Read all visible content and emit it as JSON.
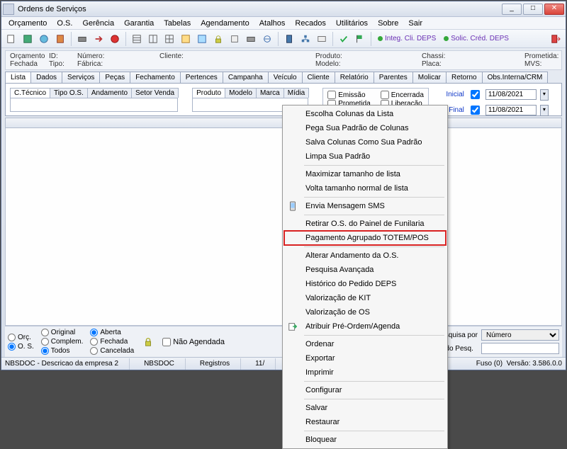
{
  "window": {
    "title": "Ordens de Serviços"
  },
  "menu": [
    "Orçamento",
    "O.S.",
    "Gerência",
    "Garantia",
    "Tabelas",
    "Agendamento",
    "Atalhos",
    "Recados",
    "Utilitários",
    "Sobre",
    "Sair"
  ],
  "toolbar_links": {
    "integ": "Integ. Cli. DEPS",
    "solic": "Solic. Créd. DEPS"
  },
  "info": {
    "r1": [
      "Orçamento",
      "ID:",
      "Número:",
      "",
      "Cliente:",
      "",
      "Produto:",
      "",
      "Chassi:",
      "",
      "Prometida:"
    ],
    "r2": [
      "Fechada",
      "Tipo:",
      "Fábrica:",
      "",
      "",
      "",
      "Modelo:",
      "",
      "Placa:",
      "",
      "MVS:"
    ]
  },
  "tabs": [
    "Lista",
    "Dados",
    "Serviços",
    "Peças",
    "Fechamento",
    "Pertences",
    "Campanha",
    "Veículo",
    "Cliente",
    "Relatório",
    "Parentes",
    "Molicar",
    "Retorno",
    "Obs.Interna/CRM"
  ],
  "subtabs1": [
    "C.Técnico",
    "Tipo O.S.",
    "Andamento",
    "Setor Venda"
  ],
  "subtabs2": [
    "Produto",
    "Modelo",
    "Marca",
    "Mídia"
  ],
  "checks": {
    "c1": "Emissão",
    "c2": "Encerrada",
    "c3": "Prometida",
    "c4": "Liberação"
  },
  "dates": {
    "inicial_label": "Inicial",
    "inicial": "11/08/2021",
    "final_label": "Final",
    "final": "11/08/2021"
  },
  "context_menu": [
    {
      "t": "item",
      "label": "Escolha Colunas da Lista"
    },
    {
      "t": "item",
      "label": "Pega Sua Padrão de Colunas"
    },
    {
      "t": "item",
      "label": "Salva Colunas Como Sua Padrão"
    },
    {
      "t": "item",
      "label": "Limpa Sua Padrão"
    },
    {
      "t": "sep"
    },
    {
      "t": "item",
      "label": "Maximizar tamanho de lista"
    },
    {
      "t": "item",
      "label": "Volta tamanho normal de lista"
    },
    {
      "t": "sep"
    },
    {
      "t": "item",
      "label": "Envia Mensagem SMS",
      "icon": "sms"
    },
    {
      "t": "sep"
    },
    {
      "t": "item",
      "label": "Retirar O.S. do Painel de Funilaria"
    },
    {
      "t": "item",
      "label": "Pagamento Agrupado TOTEM/POS",
      "hl": true
    },
    {
      "t": "sep"
    },
    {
      "t": "item",
      "label": "Alterar Andamento da O.S."
    },
    {
      "t": "item",
      "label": "Pesquisa Avançada"
    },
    {
      "t": "item",
      "label": "Histórico do Pedido DEPS"
    },
    {
      "t": "item",
      "label": "Valorização de KIT"
    },
    {
      "t": "item",
      "label": "Valorização de OS"
    },
    {
      "t": "item",
      "label": "Atribuir Pré-Ordem/Agenda",
      "icon": "assign"
    },
    {
      "t": "sep"
    },
    {
      "t": "item",
      "label": "Ordenar"
    },
    {
      "t": "item",
      "label": "Exportar"
    },
    {
      "t": "item",
      "label": "Imprimir"
    },
    {
      "t": "sep"
    },
    {
      "t": "item",
      "label": "Configurar"
    },
    {
      "t": "sep"
    },
    {
      "t": "item",
      "label": "Salvar"
    },
    {
      "t": "item",
      "label": "Restaurar"
    },
    {
      "t": "sep"
    },
    {
      "t": "item",
      "label": "Bloquear"
    }
  ],
  "footer": {
    "col1": {
      "a": "Orç.",
      "b": "O. S."
    },
    "col2": {
      "a": "Original",
      "b": "Complem.",
      "c": "Todos"
    },
    "col3": {
      "a": "Aberta",
      "b": "Fechada",
      "c": "Cancelada"
    },
    "nao_agendada": "Não Agendada",
    "search_by_label": "Pesquisa por",
    "search_by_value": "Número",
    "search_data_label": "Dado Pesq."
  },
  "status": {
    "s1": "NBSDOC - Descricao da empresa 2",
    "s2": "NBSDOC",
    "s3": "Registros",
    "s4": "11/",
    "fuso": "Fuso (0)",
    "versao": "Versão: 3.586.0.0"
  }
}
